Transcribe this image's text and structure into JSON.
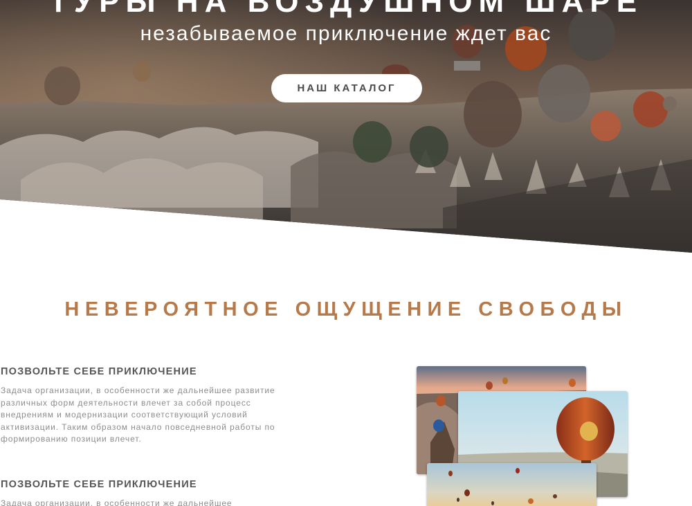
{
  "hero": {
    "title": "ТУРЫ НА ВОЗДУШНОМ ШАРЕ",
    "subtitle": "незабываемое приключение ждет вас",
    "catalog_button": "НАШ КАТАЛОГ"
  },
  "section": {
    "title": "НЕВЕРОЯТНОЕ ОЩУЩЕНИЕ СВОБОДЫ",
    "features": [
      {
        "heading": "ПОЗВОЛЬТЕ СЕБЕ ПРИКЛЮЧЕНИЕ",
        "text": "Задача организации, в особенности же дальнейшее развитие различных форм деятельности влечет за собой процесс внедрениям и модернизации соответствующий условий активизации. Таким образом начало повседневной работы по формированию позиции влечет."
      },
      {
        "heading": "ПОЗВОЛЬТЕ СЕБЕ ПРИКЛЮЧЕНИЕ",
        "text": "Задача организации, в особенности же дальнейшее"
      }
    ]
  },
  "colors": {
    "accent": "#b5794a",
    "heading_gray": "#555555",
    "text_gray": "#8c8c8c",
    "button_bg": "#ffffff"
  }
}
